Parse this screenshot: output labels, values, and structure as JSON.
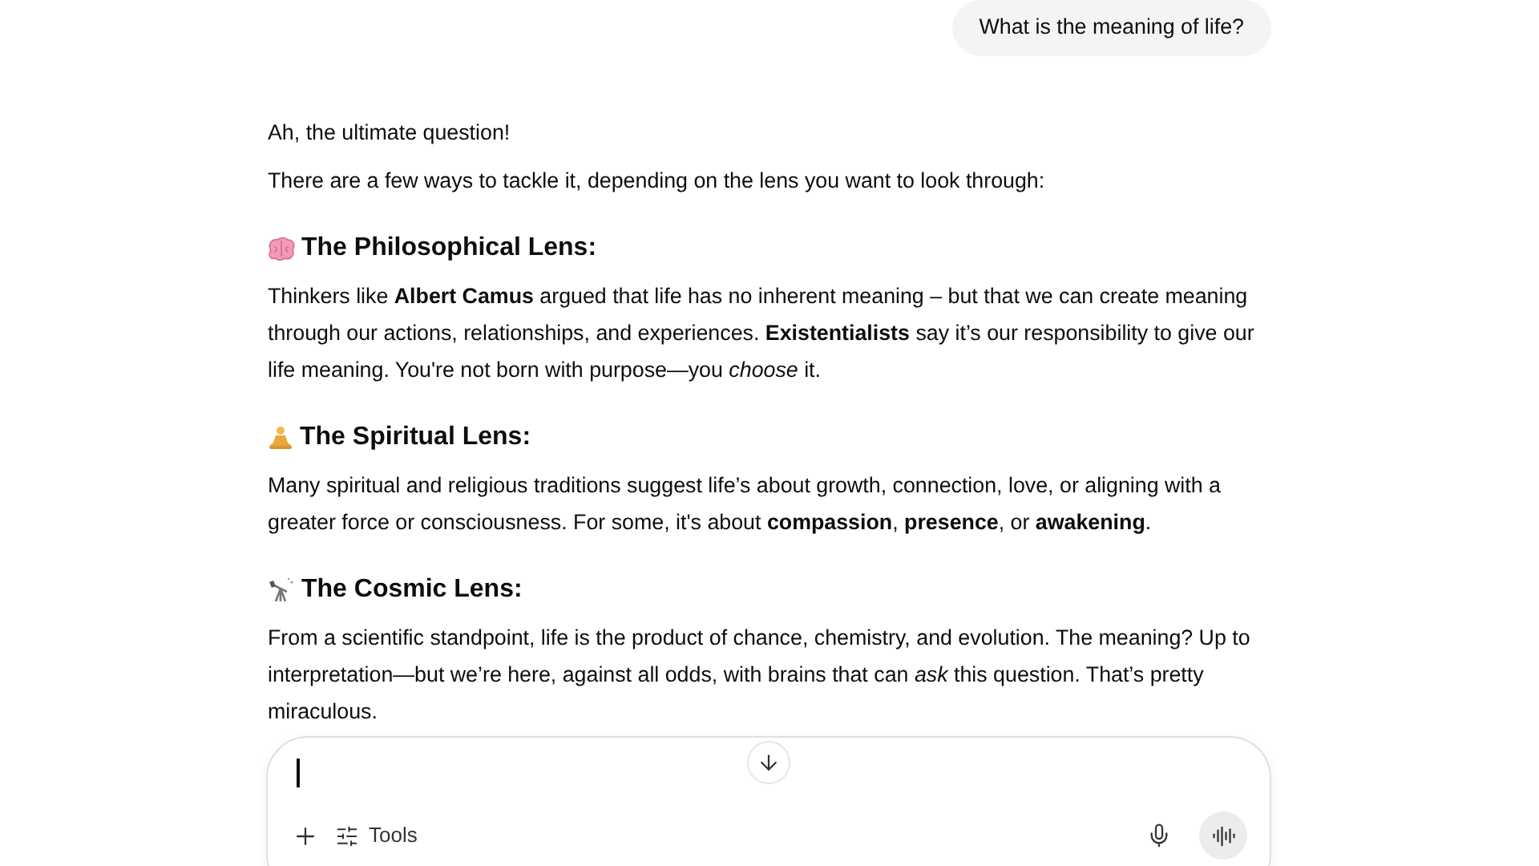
{
  "user_message": "What is the meaning of life?",
  "reply": {
    "paragraphs": [
      "Ah, the ultimate question!",
      "There are a few ways to tackle it, depending on the lens you want to look through:"
    ],
    "sections": [
      {
        "kind": "brain",
        "heading": "The Philosophical Lens:",
        "body": "Thinkers like **Albert Camus** argued that life has no inherent meaning – but that we can create meaning through our actions, relationships, and experiences. **Existentialists** say it’s our responsibility to give our life meaning. You're not born with purpose—you *choose* it."
      },
      {
        "kind": "meditation",
        "heading": "The Spiritual Lens:",
        "body": "Many spiritual and religious traditions suggest life’s about growth, connection, love, or aligning with a greater force or consciousness. For some, it's about **compassion**, **presence**, or **awakening**."
      },
      {
        "kind": "telescope",
        "heading": "The Cosmic Lens:",
        "body": "From a scientific standpoint, life is the product of chance, chemistry, and evolution. The meaning? Up to interpretation—but we’re here, against all odds, with brains that can *ask* this question. That’s pretty miraculous."
      }
    ]
  },
  "composer": {
    "tools_label": "Tools"
  }
}
